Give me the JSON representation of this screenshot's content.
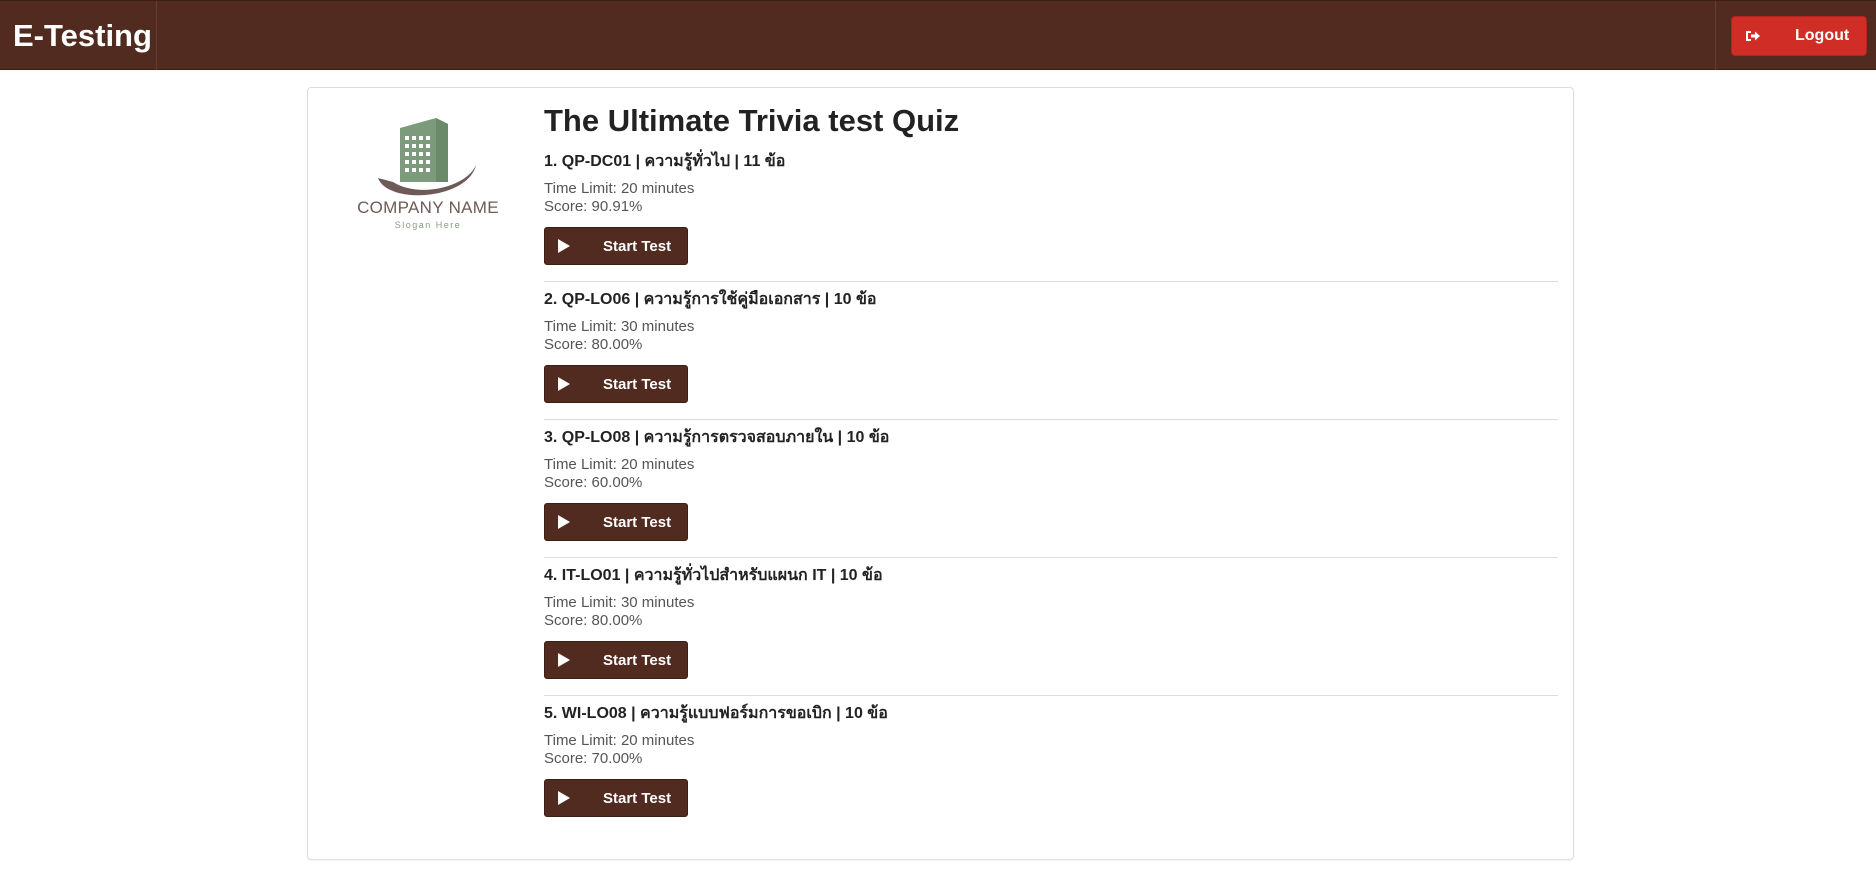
{
  "app": {
    "brand": "E-Testing"
  },
  "header": {
    "logout_label": "Logout",
    "logout_icon": "sign-out-icon"
  },
  "logo": {
    "company": "COMPANY NAME",
    "slogan": "Slogan Here"
  },
  "quiz": {
    "title": "The Ultimate Trivia test Quiz",
    "start_label": "Start Test",
    "start_icon": "play-icon",
    "items": [
      {
        "title": "1. QP-DC01 | ความรู้ทั่วไป | 11 ข้อ",
        "time_limit": "Time Limit: 20 minutes",
        "score": "Score: 90.91%"
      },
      {
        "title": "2. QP-LO06 | ความรู้การใช้คู่มือเอกสาร | 10 ข้อ",
        "time_limit": "Time Limit: 30 minutes",
        "score": "Score: 80.00%"
      },
      {
        "title": "3. QP-LO08 | ความรู้การตรวจสอบภายใน | 10 ข้อ",
        "time_limit": "Time Limit: 20 minutes",
        "score": "Score: 60.00%"
      },
      {
        "title": "4. IT-LO01 | ความรู้ทั่วไปสำหรับแผนก IT | 10 ข้อ",
        "time_limit": "Time Limit: 30 minutes",
        "score": "Score: 80.00%"
      },
      {
        "title": "5. WI-LO08 | ความรู้แบบฟอร์มการขอเบิก | 10 ข้อ",
        "time_limit": "Time Limit: 20 minutes",
        "score": "Score: 70.00%"
      }
    ]
  },
  "colors": {
    "navbar": "#512b1f",
    "logout": "#cf2d26",
    "button": "#512b1f"
  }
}
